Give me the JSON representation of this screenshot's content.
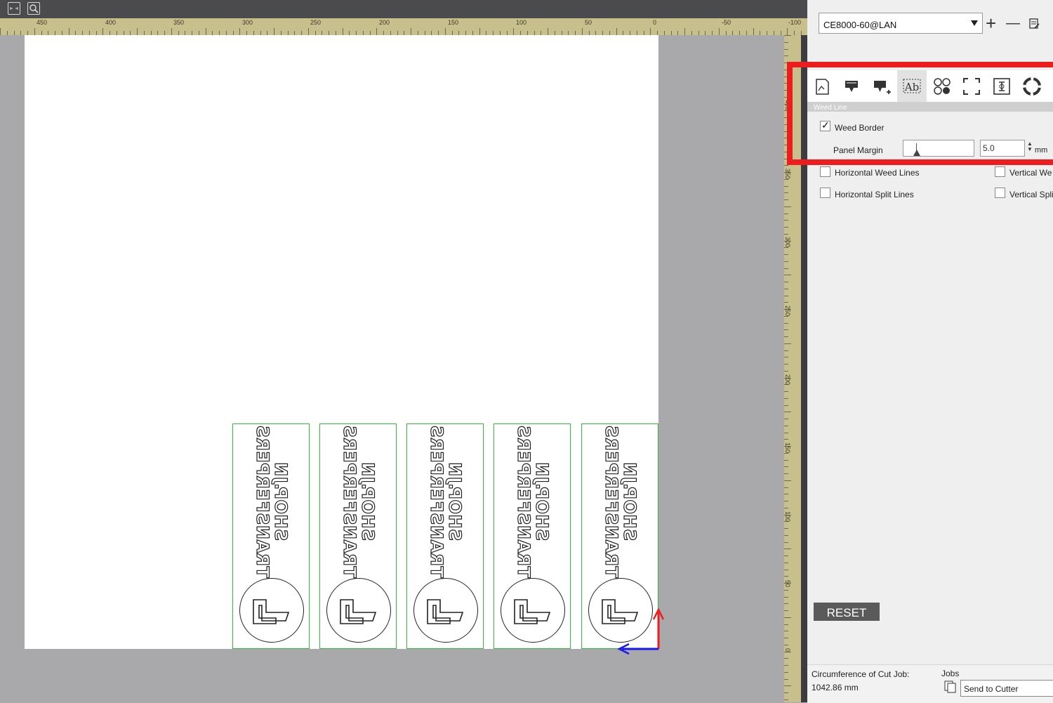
{
  "toolbar": {
    "buttons": [
      {
        "icon": "fit-page-icon"
      },
      {
        "icon": "zoom-icon"
      }
    ]
  },
  "rulers": {
    "top_labels": [
      "450",
      "400",
      "350",
      "300",
      "250",
      "200",
      "150",
      "100",
      "50",
      "0",
      "-50",
      "-100"
    ],
    "right_labels": [
      "400",
      "350",
      "300",
      "250",
      "200",
      "150",
      "100",
      "50",
      "0"
    ]
  },
  "canvas": {
    "strip_text": [
      "SHOP.JN",
      "TRANSFERPERS"
    ],
    "strip_count": 5,
    "colors": {
      "strip_border": "#2fbf3a",
      "page": "#ffffff",
      "x_axis": "#1a1aee",
      "y_axis": "#ee1c1c"
    }
  },
  "device": {
    "selected": "CE8000-60@LAN",
    "add_button": "+",
    "remove_button": "—"
  },
  "tabs": [
    {
      "name": "page-setup",
      "icon": "page-icon"
    },
    {
      "name": "cut-settings",
      "icon": "cutter-icon"
    },
    {
      "name": "add-cut-settings",
      "icon": "cutter-plus-icon"
    },
    {
      "name": "weed-line",
      "icon": "weed-text-icon",
      "active": true
    },
    {
      "name": "registration-marks",
      "icon": "reg-marks-icon"
    },
    {
      "name": "tiling",
      "icon": "tiling-icon"
    },
    {
      "name": "cut-by-color",
      "icon": "cut-by-color-icon"
    },
    {
      "name": "support",
      "icon": "lifebuoy-icon"
    }
  ],
  "weed_line": {
    "section_title": "Weed Line",
    "weed_border": {
      "label": "Weed Border",
      "checked": true
    },
    "panel_margin": {
      "label": "Panel Margin",
      "value": "5.0",
      "unit": "mm"
    },
    "options": [
      {
        "label": "Horizontal Weed Lines",
        "checked": false
      },
      {
        "label": "Vertical Weed Lines",
        "checked": false,
        "shown": "Vertical We"
      },
      {
        "label": "Horizontal Split Lines",
        "checked": false
      },
      {
        "label": "Vertical Split Lines",
        "checked": false,
        "shown": "Vertical Spli"
      }
    ],
    "reset_label": "RESET"
  },
  "status": {
    "circumference_label": "Circumference of Cut Job:",
    "circumference_value": "1042.86 mm",
    "jobs_label": "Jobs",
    "send_to_label": "Send to Cutter"
  },
  "highlight_color": "#ee1c1c"
}
